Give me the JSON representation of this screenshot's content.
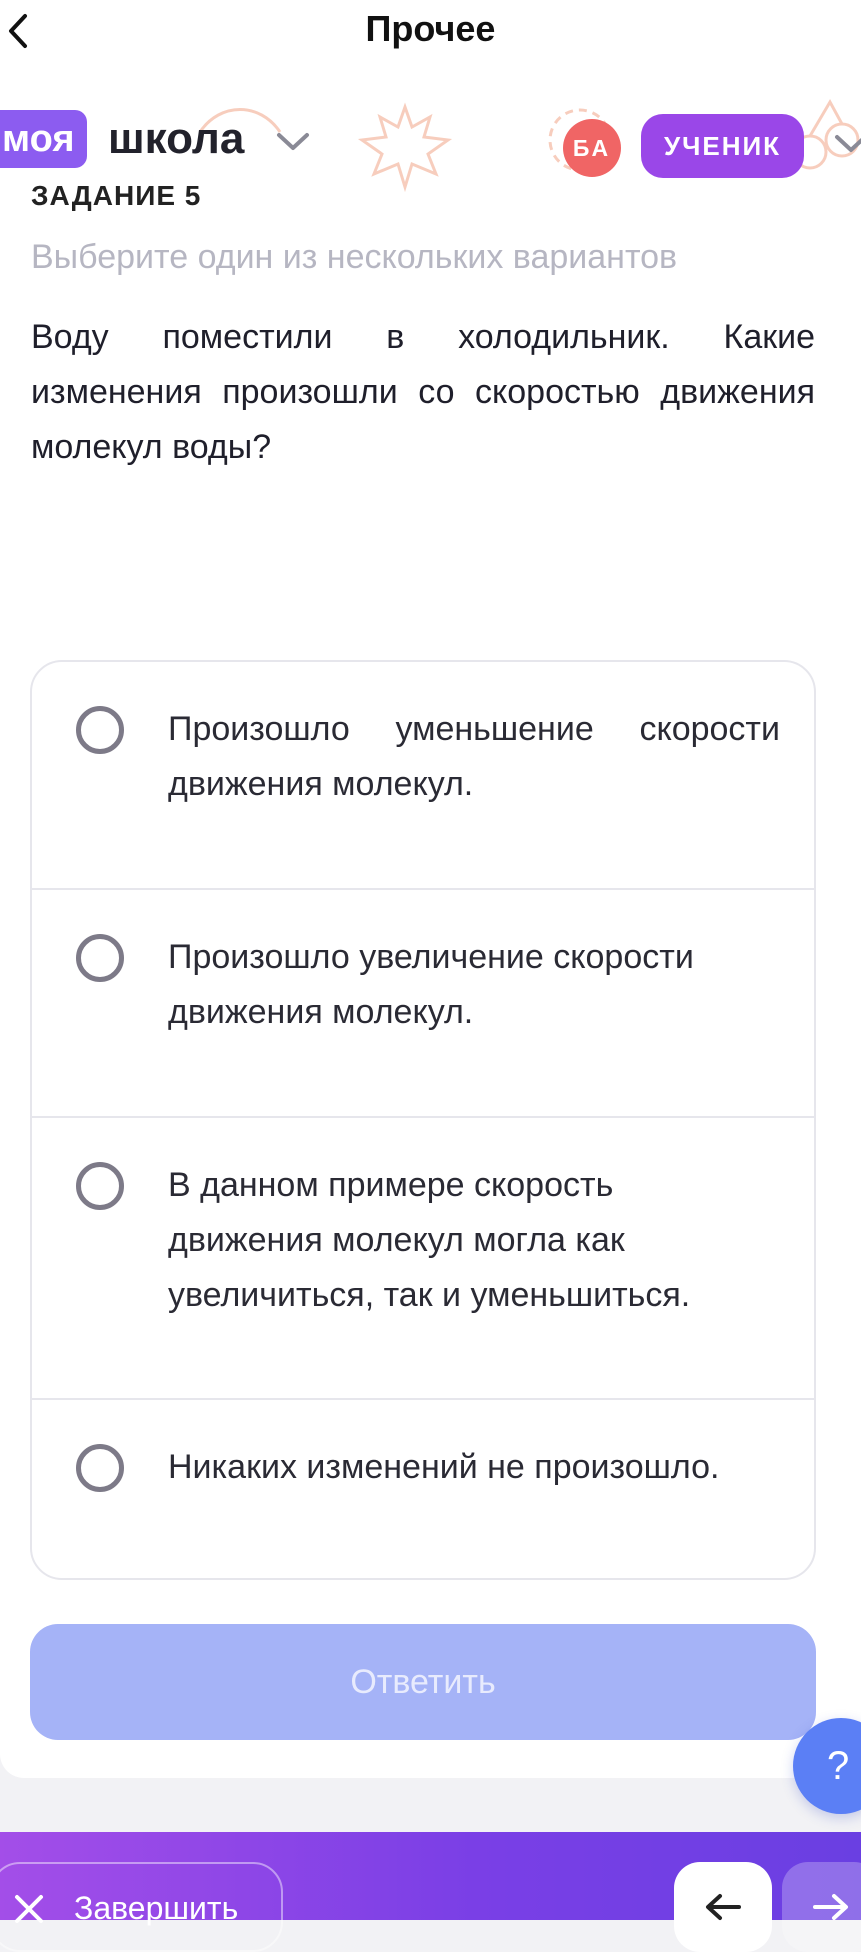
{
  "topbar": {
    "title": "Прочее"
  },
  "brand": {
    "logo_part1": "моя",
    "logo_part2": "школа",
    "avatar_initials": "БА",
    "role_label": "УЧЕНИК"
  },
  "task": {
    "label": "ЗАДАНИЕ 5",
    "hint": "Выберите один из нескольких вариантов",
    "question": "Воду поместили в холодильник. Какие изменения произошли со скоростью движения молекул воды?"
  },
  "options": [
    {
      "text": "Произошло уменьшение скорости движения молекул.",
      "selected": false
    },
    {
      "text": "Произошло увеличение скорости движения молекул.",
      "selected": false
    },
    {
      "text": "В данном примере скорость движения молекул могла как увеличиться, так и уменьшиться.",
      "selected": false
    },
    {
      "text": "Никаких изменений не произошло.",
      "selected": false
    }
  ],
  "submit": {
    "label": "Ответить",
    "enabled": false
  },
  "help": {
    "label": "?"
  },
  "footer": {
    "finish_label": "Завершить"
  },
  "icons": {
    "back": "chevron-left-icon",
    "school_dropdown": "chevron-down-icon",
    "role_dropdown": "chevron-down-icon",
    "finish": "close-icon",
    "prev": "arrow-left-icon",
    "next": "arrow-right-icon"
  },
  "colors": {
    "brand_purple": "#8c5cf0",
    "role_purple": "#9a47e8",
    "avatar_red": "#f06565",
    "submit_disabled": "#a5b3f7",
    "help_blue": "#5b7ff5"
  }
}
